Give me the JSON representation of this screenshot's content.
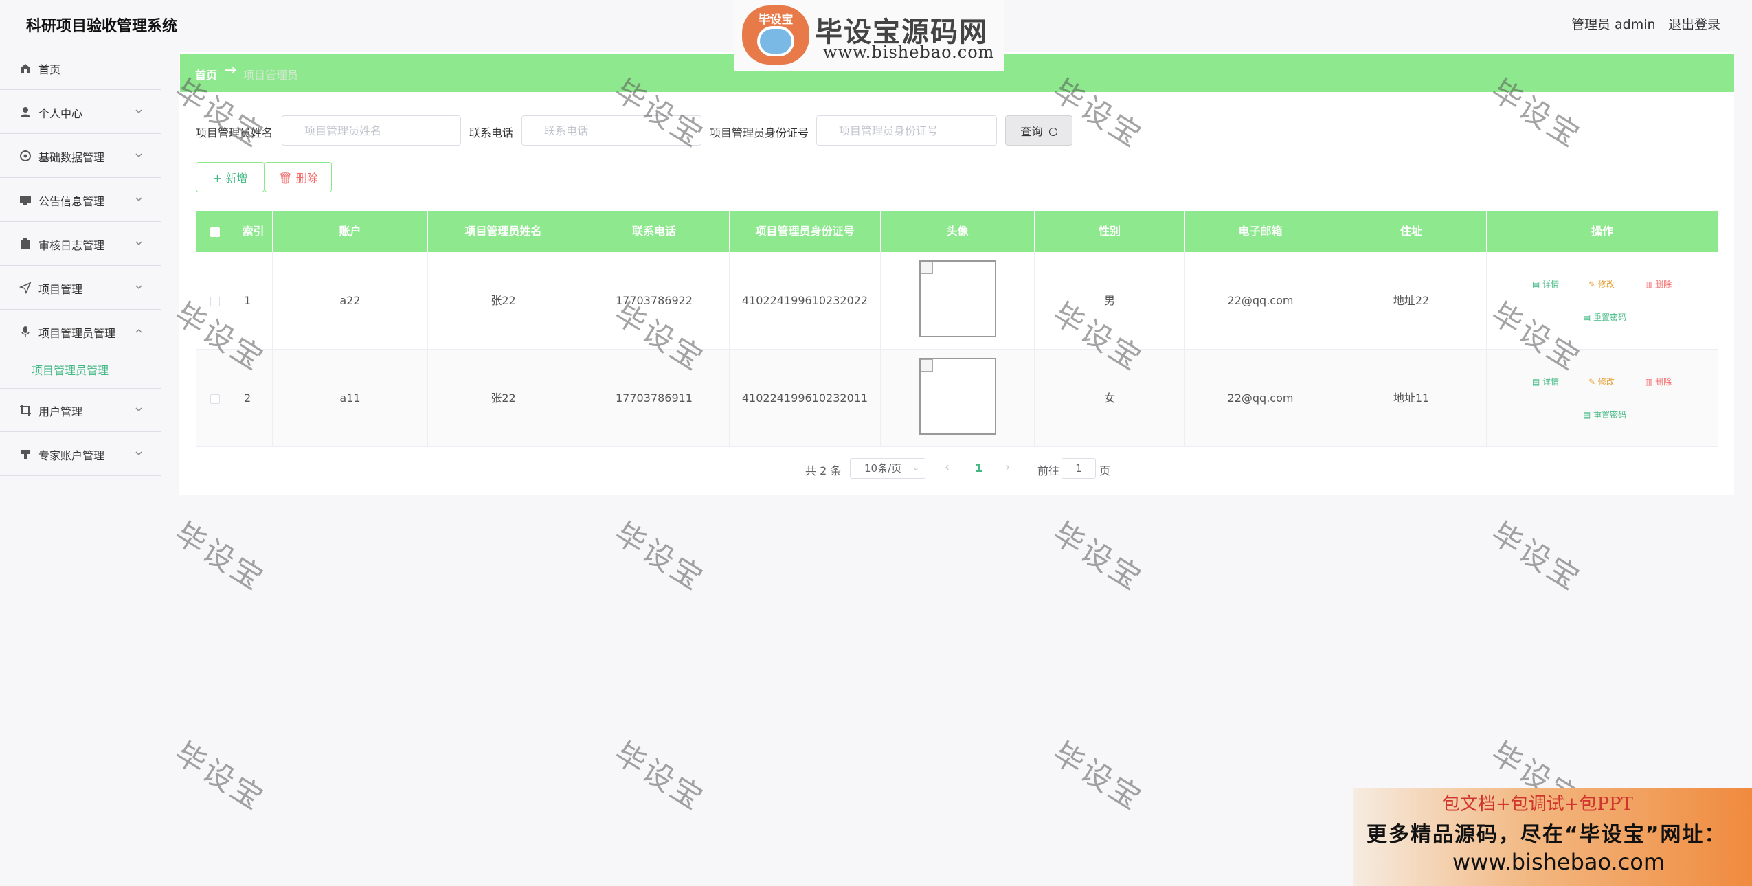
{
  "header": {
    "app_title": "科研项目验收管理系统",
    "admin_label": "管理员 admin",
    "logout": "退出登录"
  },
  "logo": {
    "badge_text": "毕设宝",
    "title": "毕设宝源码网",
    "url": "www.bishebao.com"
  },
  "sidebar": {
    "items": [
      {
        "label": "首页",
        "icon": "home-icon"
      },
      {
        "label": "个人中心",
        "icon": "user-icon"
      },
      {
        "label": "基础数据管理",
        "icon": "gear-icon"
      },
      {
        "label": "公告信息管理",
        "icon": "monitor-icon"
      },
      {
        "label": "审核日志管理",
        "icon": "clipboard-icon"
      },
      {
        "label": "项目管理",
        "icon": "send-icon"
      },
      {
        "label": "项目管理员管理",
        "icon": "microphone-icon"
      },
      {
        "label": "用户管理",
        "icon": "crop-icon"
      },
      {
        "label": "专家账户管理",
        "icon": "stamp-icon"
      }
    ],
    "active_sub": "项目管理员管理"
  },
  "breadcrumb": {
    "home": "首页",
    "arrow": "→",
    "current": "项目管理员"
  },
  "search": {
    "name_label": "项目管理员姓名",
    "name_placeholder": "项目管理员姓名",
    "phone_label": "联系电话",
    "phone_placeholder": "联系电话",
    "id_label": "项目管理员身份证号",
    "id_placeholder": "项目管理员身份证号",
    "query_label": "查询"
  },
  "actions": {
    "add": "新增",
    "delete": "删除"
  },
  "table": {
    "headers": [
      "索引",
      "账户",
      "项目管理员姓名",
      "联系电话",
      "项目管理员身份证号",
      "头像",
      "性别",
      "电子邮箱",
      "住址",
      "操作"
    ],
    "rows": [
      {
        "index": "1",
        "account": "a22",
        "name": "张22",
        "phone": "17703786922",
        "id_card": "410224199610232022",
        "gender": "男",
        "email": "22@qq.com",
        "address": "地址22"
      },
      {
        "index": "2",
        "account": "a11",
        "name": "张22",
        "phone": "17703786911",
        "id_card": "410224199610232011",
        "gender": "女",
        "email": "22@qq.com",
        "address": "地址11"
      }
    ],
    "ops": {
      "detail": "详情",
      "edit": "修改",
      "delete": "删除",
      "reset": "重置密码"
    }
  },
  "pagination": {
    "total": "共 2 条",
    "page_size": "10条/页",
    "prev": "‹",
    "current": "1",
    "next": "›",
    "goto": "前往",
    "goto_value": "1",
    "page_word": "页"
  },
  "watermark": "毕设宝",
  "promo": {
    "line1": "包文档+包调试+包PPT",
    "line2": "更多精品源码，尽在“毕设宝”网址：",
    "line3": "www.bishebao.com"
  }
}
